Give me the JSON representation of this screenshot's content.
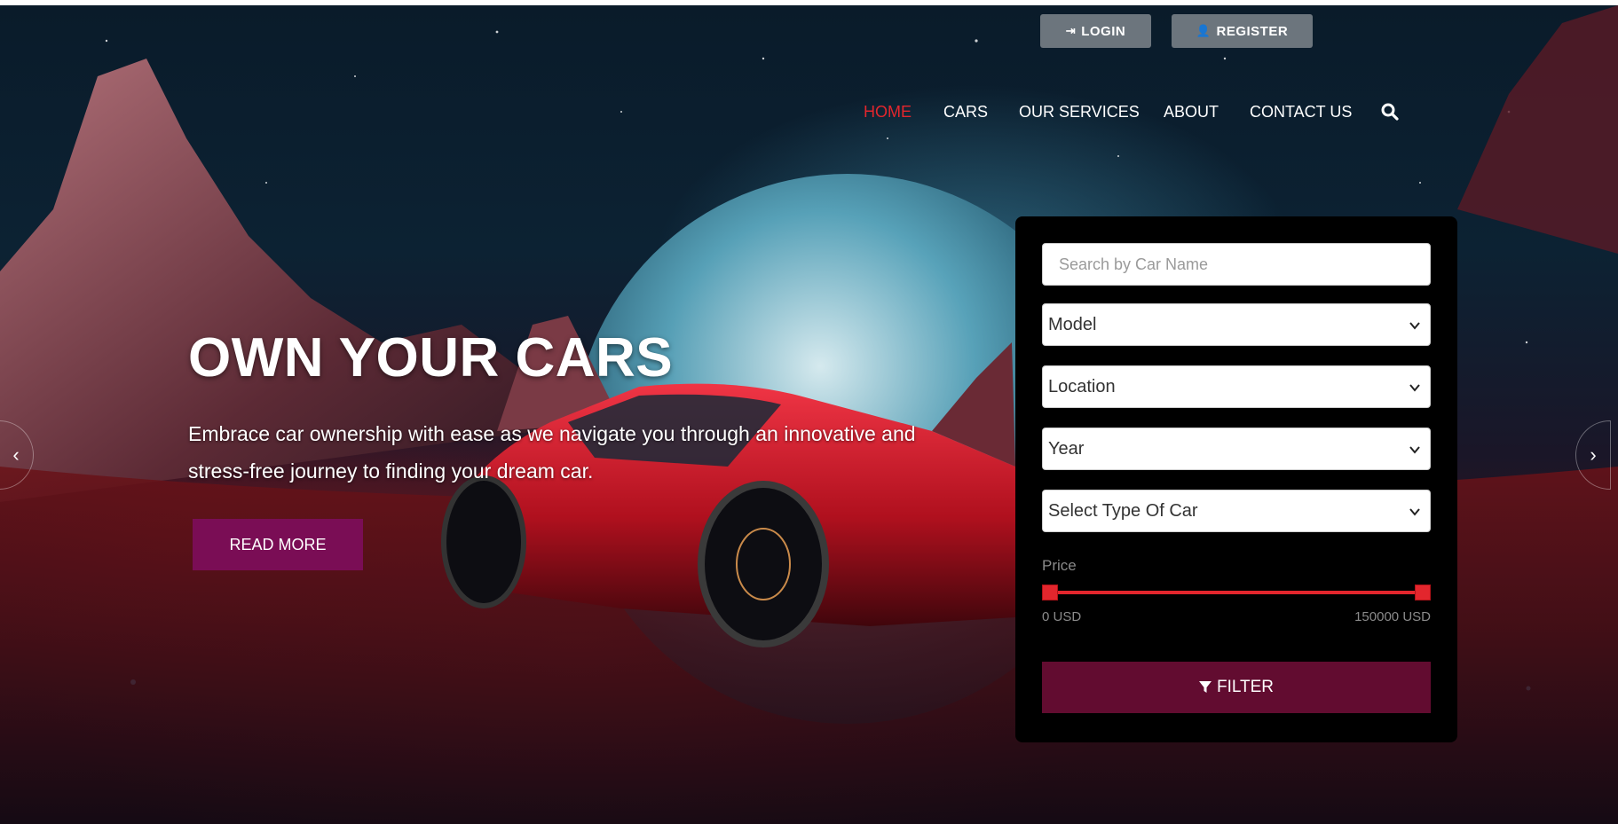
{
  "auth": {
    "login_label": "LOGIN",
    "register_label": "REGISTER"
  },
  "nav": {
    "items": [
      {
        "label": "HOME",
        "active": true
      },
      {
        "label": "CARS",
        "active": false
      },
      {
        "label": "OUR SERVICES",
        "active": false
      },
      {
        "label": "ABOUT",
        "active": false
      },
      {
        "label": "CONTACT US",
        "active": false
      }
    ],
    "search_icon": "search-icon"
  },
  "hero": {
    "title": "OWN YOUR CARS",
    "description": "Embrace car ownership with ease as we navigate you through an innovative and stress-free journey to finding your dream car.",
    "read_more_label": "READ MORE"
  },
  "filter": {
    "search_placeholder": "Search by Car Name",
    "model_selected": "Model",
    "location_selected": "Location",
    "year_selected": "Year",
    "type_selected": "Select Type Of Car",
    "price_label": "Price",
    "price_min": "0 USD",
    "price_max": "150000 USD",
    "filter_label": "FILTER"
  },
  "colors": {
    "accent_red": "#e3262d",
    "read_more_bg": "#7a0d55",
    "filter_btn_bg": "#620c30",
    "auth_btn_bg": "#6c757d"
  }
}
